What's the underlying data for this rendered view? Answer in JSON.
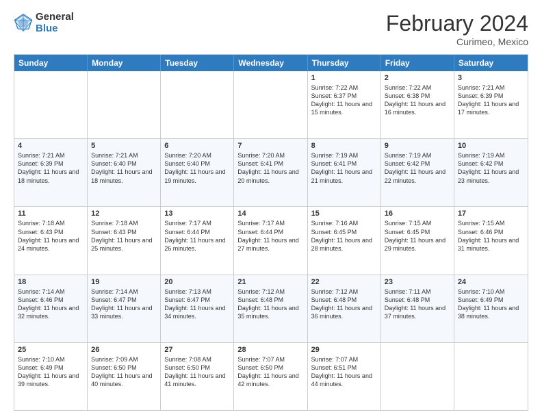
{
  "header": {
    "logo_general": "General",
    "logo_blue": "Blue",
    "title": "February 2024",
    "subtitle": "Curimeo, Mexico"
  },
  "calendar": {
    "days_of_week": [
      "Sunday",
      "Monday",
      "Tuesday",
      "Wednesday",
      "Thursday",
      "Friday",
      "Saturday"
    ],
    "rows": [
      {
        "alt": false,
        "cells": [
          {
            "day": "",
            "text": ""
          },
          {
            "day": "",
            "text": ""
          },
          {
            "day": "",
            "text": ""
          },
          {
            "day": "",
            "text": ""
          },
          {
            "day": "1",
            "text": "Sunrise: 7:22 AM\nSunset: 6:37 PM\nDaylight: 11 hours and 15 minutes."
          },
          {
            "day": "2",
            "text": "Sunrise: 7:22 AM\nSunset: 6:38 PM\nDaylight: 11 hours and 16 minutes."
          },
          {
            "day": "3",
            "text": "Sunrise: 7:21 AM\nSunset: 6:39 PM\nDaylight: 11 hours and 17 minutes."
          }
        ]
      },
      {
        "alt": true,
        "cells": [
          {
            "day": "4",
            "text": "Sunrise: 7:21 AM\nSunset: 6:39 PM\nDaylight: 11 hours and 18 minutes."
          },
          {
            "day": "5",
            "text": "Sunrise: 7:21 AM\nSunset: 6:40 PM\nDaylight: 11 hours and 18 minutes."
          },
          {
            "day": "6",
            "text": "Sunrise: 7:20 AM\nSunset: 6:40 PM\nDaylight: 11 hours and 19 minutes."
          },
          {
            "day": "7",
            "text": "Sunrise: 7:20 AM\nSunset: 6:41 PM\nDaylight: 11 hours and 20 minutes."
          },
          {
            "day": "8",
            "text": "Sunrise: 7:19 AM\nSunset: 6:41 PM\nDaylight: 11 hours and 21 minutes."
          },
          {
            "day": "9",
            "text": "Sunrise: 7:19 AM\nSunset: 6:42 PM\nDaylight: 11 hours and 22 minutes."
          },
          {
            "day": "10",
            "text": "Sunrise: 7:19 AM\nSunset: 6:42 PM\nDaylight: 11 hours and 23 minutes."
          }
        ]
      },
      {
        "alt": false,
        "cells": [
          {
            "day": "11",
            "text": "Sunrise: 7:18 AM\nSunset: 6:43 PM\nDaylight: 11 hours and 24 minutes."
          },
          {
            "day": "12",
            "text": "Sunrise: 7:18 AM\nSunset: 6:43 PM\nDaylight: 11 hours and 25 minutes."
          },
          {
            "day": "13",
            "text": "Sunrise: 7:17 AM\nSunset: 6:44 PM\nDaylight: 11 hours and 26 minutes."
          },
          {
            "day": "14",
            "text": "Sunrise: 7:17 AM\nSunset: 6:44 PM\nDaylight: 11 hours and 27 minutes."
          },
          {
            "day": "15",
            "text": "Sunrise: 7:16 AM\nSunset: 6:45 PM\nDaylight: 11 hours and 28 minutes."
          },
          {
            "day": "16",
            "text": "Sunrise: 7:15 AM\nSunset: 6:45 PM\nDaylight: 11 hours and 29 minutes."
          },
          {
            "day": "17",
            "text": "Sunrise: 7:15 AM\nSunset: 6:46 PM\nDaylight: 11 hours and 31 minutes."
          }
        ]
      },
      {
        "alt": true,
        "cells": [
          {
            "day": "18",
            "text": "Sunrise: 7:14 AM\nSunset: 6:46 PM\nDaylight: 11 hours and 32 minutes."
          },
          {
            "day": "19",
            "text": "Sunrise: 7:14 AM\nSunset: 6:47 PM\nDaylight: 11 hours and 33 minutes."
          },
          {
            "day": "20",
            "text": "Sunrise: 7:13 AM\nSunset: 6:47 PM\nDaylight: 11 hours and 34 minutes."
          },
          {
            "day": "21",
            "text": "Sunrise: 7:12 AM\nSunset: 6:48 PM\nDaylight: 11 hours and 35 minutes."
          },
          {
            "day": "22",
            "text": "Sunrise: 7:12 AM\nSunset: 6:48 PM\nDaylight: 11 hours and 36 minutes."
          },
          {
            "day": "23",
            "text": "Sunrise: 7:11 AM\nSunset: 6:48 PM\nDaylight: 11 hours and 37 minutes."
          },
          {
            "day": "24",
            "text": "Sunrise: 7:10 AM\nSunset: 6:49 PM\nDaylight: 11 hours and 38 minutes."
          }
        ]
      },
      {
        "alt": false,
        "cells": [
          {
            "day": "25",
            "text": "Sunrise: 7:10 AM\nSunset: 6:49 PM\nDaylight: 11 hours and 39 minutes."
          },
          {
            "day": "26",
            "text": "Sunrise: 7:09 AM\nSunset: 6:50 PM\nDaylight: 11 hours and 40 minutes."
          },
          {
            "day": "27",
            "text": "Sunrise: 7:08 AM\nSunset: 6:50 PM\nDaylight: 11 hours and 41 minutes."
          },
          {
            "day": "28",
            "text": "Sunrise: 7:07 AM\nSunset: 6:50 PM\nDaylight: 11 hours and 42 minutes."
          },
          {
            "day": "29",
            "text": "Sunrise: 7:07 AM\nSunset: 6:51 PM\nDaylight: 11 hours and 44 minutes."
          },
          {
            "day": "",
            "text": ""
          },
          {
            "day": "",
            "text": ""
          }
        ]
      }
    ]
  }
}
